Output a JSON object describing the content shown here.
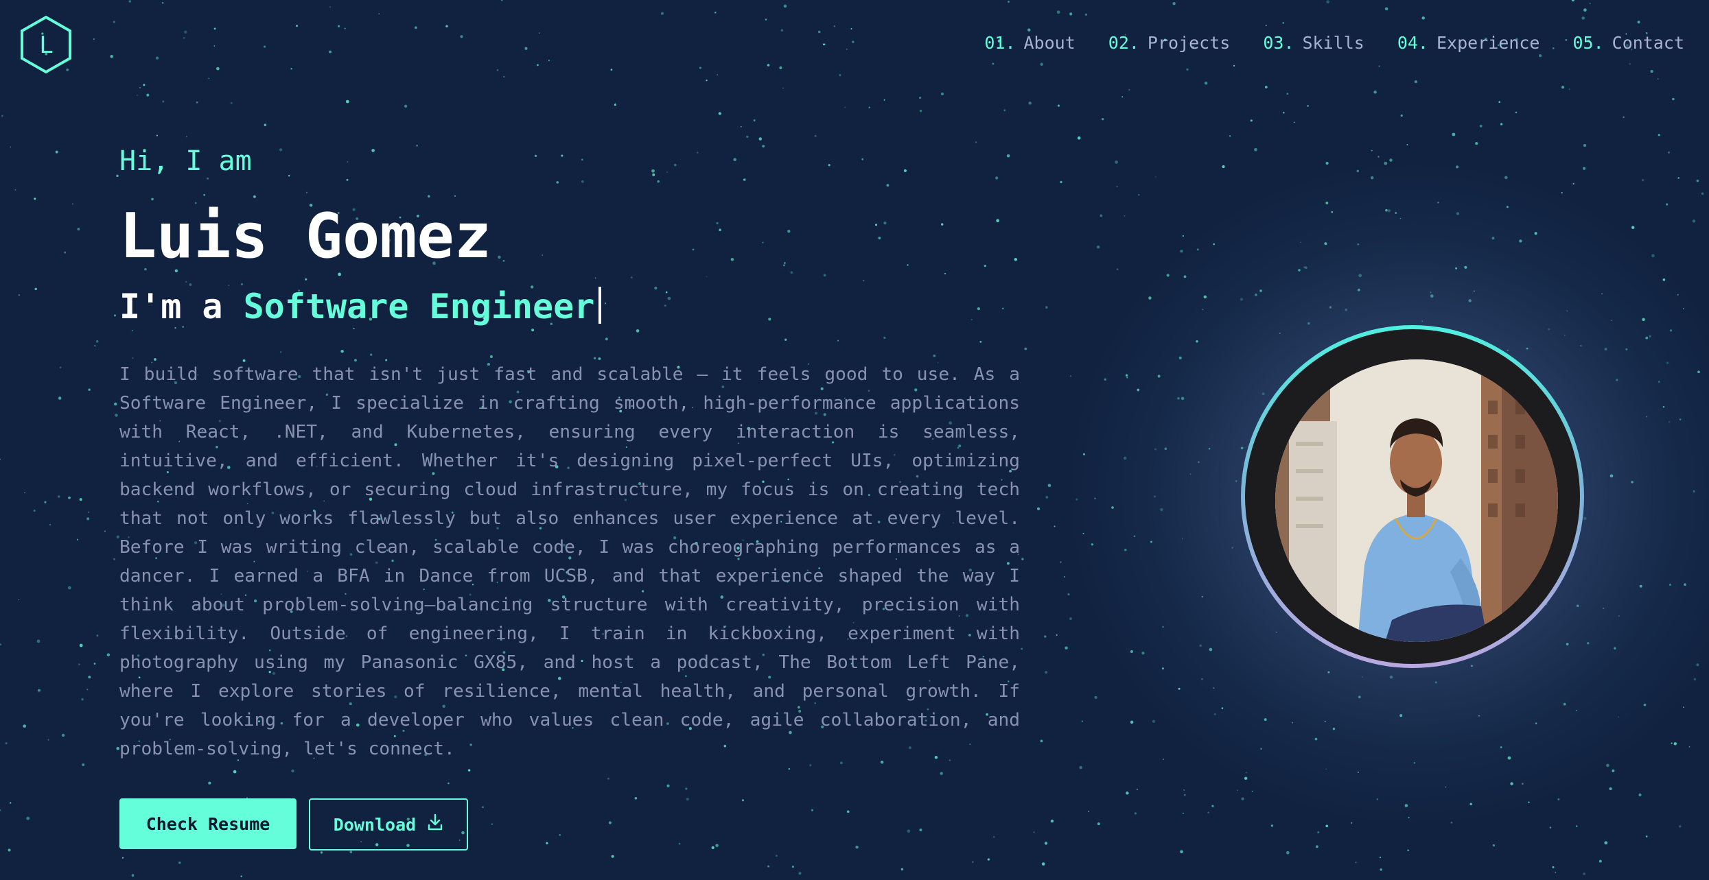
{
  "logo": {
    "letter": "L"
  },
  "nav": [
    {
      "num": "01.",
      "label": "About"
    },
    {
      "num": "02.",
      "label": "Projects"
    },
    {
      "num": "03.",
      "label": "Skills"
    },
    {
      "num": "04.",
      "label": "Experience"
    },
    {
      "num": "05.",
      "label": "Contact"
    }
  ],
  "hero": {
    "greeting": "Hi, I am",
    "name": "Luis Gomez",
    "role_prefix": "I'm a ",
    "role": "Software Engineer",
    "bio": "I build software that isn't just fast and scalable — it feels good to use. As a Software Engineer, I specialize in crafting smooth, high-performance applications with React, .NET, and Kubernetes, ensuring every interaction is seamless, intuitive, and efficient. Whether it's designing pixel-perfect UIs, optimizing backend workflows, or securing cloud infrastructure, my focus is on creating tech that not only works flawlessly but also enhances user experience at every level. Before I was writing clean, scalable code, I was choreographing performances as a dancer. I earned a BFA in Dance from UCSB, and that experience shaped the way I think about problem-solving—balancing structure with creativity, precision with flexibility. Outside of engineering, I train in kickboxing, experiment with photography using my Panasonic GX85, and host a podcast, The Bottom Left Pane, where I explore stories of resilience, mental health, and personal growth. If you're looking for a developer who values clean code, agile collaboration, and problem-solving, let's connect."
  },
  "buttons": {
    "resume": "Check Resume",
    "download": "Download",
    "download_icon": "download-icon"
  },
  "portrait": {
    "icon": "profile-photo"
  },
  "colors": {
    "background": "#112240",
    "accent": "#64ffda",
    "heading": "#ffffff",
    "text": "#8892b0",
    "nav_text": "#a8b2d1"
  }
}
